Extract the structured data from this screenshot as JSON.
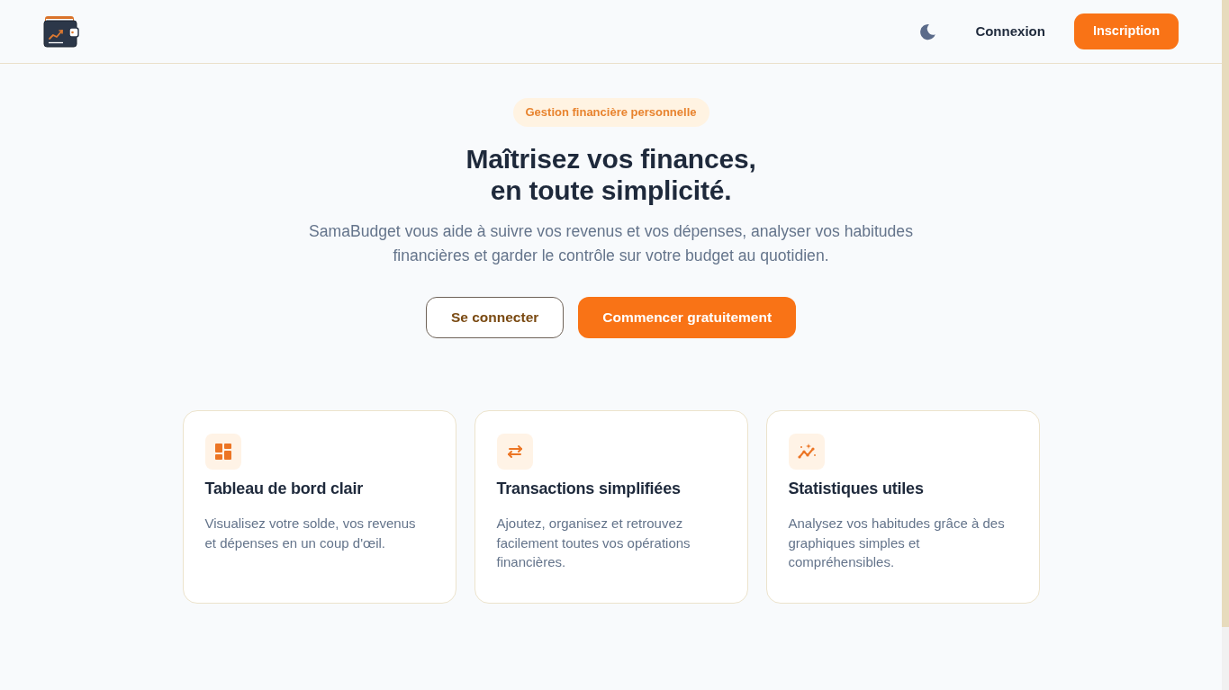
{
  "navbar": {
    "links": [
      {
        "label": "Connexion",
        "kind": "link"
      },
      {
        "label": "Inscription",
        "kind": "button"
      }
    ]
  },
  "hero": {
    "badge": "Gestion financière personnelle",
    "title_lines": [
      "Maîtrisez vos finances,",
      "en toute simplicité."
    ],
    "description": "SamaBudget vous aide à suivre vos revenus et vos dépenses, analyser vos habitudes financières et garder le contrôle sur votre budget au quotidien.",
    "actions": [
      {
        "label": "Se connecter",
        "kind": "outline"
      },
      {
        "label": "Commencer gratuitement",
        "kind": "primary"
      }
    ]
  },
  "features": [
    {
      "title": "Tableau de bord clair",
      "text": "Visualisez votre solde, vos revenus et dépenses en un coup d'œil."
    },
    {
      "title": "Transactions simplifiées",
      "text": "Ajoutez, organisez et retrouvez facilement toutes vos opérations financières."
    },
    {
      "title": "Statistiques utiles",
      "text": "Analysez vos habitudes grâce à des graphiques simples et compréhensibles."
    }
  ]
}
